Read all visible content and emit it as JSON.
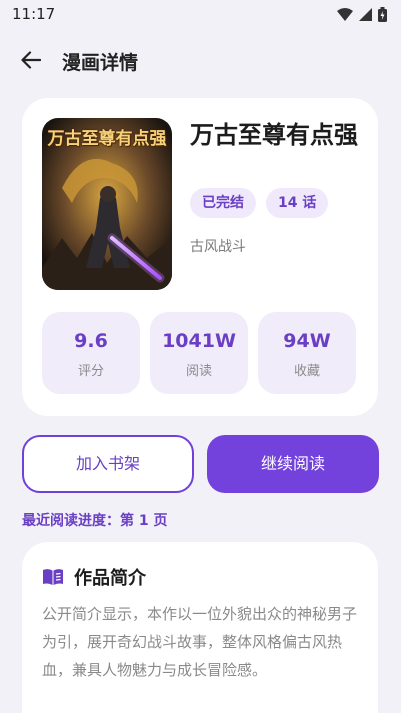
{
  "status_bar": {
    "time": "11:17"
  },
  "app_bar": {
    "title": "漫画详情"
  },
  "comic": {
    "cover_text": "万古至尊有点强",
    "title": "万古至尊有点强",
    "tags": [
      "已完结",
      "14 话"
    ],
    "genre": "古风战斗"
  },
  "stats": [
    {
      "value": "9.6",
      "label": "评分"
    },
    {
      "value": "1041W",
      "label": "阅读"
    },
    {
      "value": "94W",
      "label": "收藏"
    }
  ],
  "actions": {
    "add_shelf": "加入书架",
    "continue_read": "继续阅读"
  },
  "progress": "最近阅读进度：第 1 页",
  "intro": {
    "title": "作品简介",
    "text": "公开简介显示，本作以一位外貌出众的神秘男子为引，展开奇幻战斗故事，整体风格偏古风热血，兼具人物魅力与成长冒险感。"
  },
  "colors": {
    "accent": "#7342dd",
    "accent_light": "#efe9fb",
    "background": "#f3f1f8"
  }
}
